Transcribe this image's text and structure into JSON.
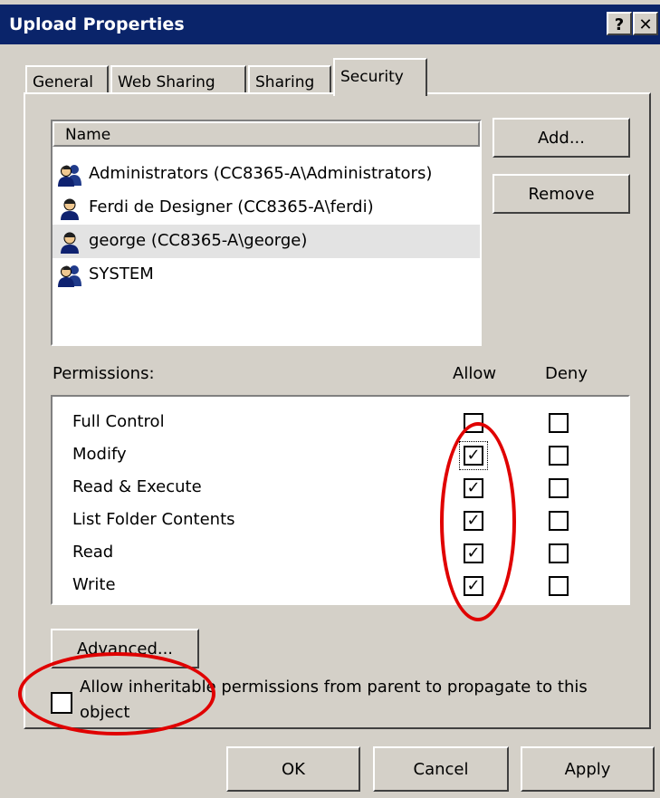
{
  "window": {
    "title": "Upload Properties",
    "help_label": "?",
    "close_label": "✕"
  },
  "tabs": [
    {
      "label": "General",
      "active": false
    },
    {
      "label": "Web Sharing",
      "active": false
    },
    {
      "label": "Sharing",
      "active": false
    },
    {
      "label": "Security",
      "active": true
    }
  ],
  "users": {
    "column_header": "Name",
    "items": [
      {
        "label": "Administrators (CC8365-A\\Administrators)",
        "icon": "group-users-icon",
        "selected": false
      },
      {
        "label": "Ferdi de Designer (CC8365-A\\ferdi)",
        "icon": "user-icon",
        "selected": false
      },
      {
        "label": "george (CC8365-A\\george)",
        "icon": "user-icon",
        "selected": true
      },
      {
        "label": "SYSTEM",
        "icon": "group-users-icon",
        "selected": false
      }
    ],
    "add_label": "Add...",
    "remove_label": "Remove"
  },
  "permissions": {
    "label": "Permissions:",
    "allow_header": "Allow",
    "deny_header": "Deny",
    "check_glyph": "✓",
    "rows": [
      {
        "name": "Full Control",
        "allow": false,
        "deny": false
      },
      {
        "name": "Modify",
        "allow": true,
        "deny": false
      },
      {
        "name": "Read & Execute",
        "allow": true,
        "deny": false
      },
      {
        "name": "List Folder Contents",
        "allow": true,
        "deny": false
      },
      {
        "name": "Read",
        "allow": true,
        "deny": false
      },
      {
        "name": "Write",
        "allow": true,
        "deny": false
      }
    ]
  },
  "advanced_label": "Advanced...",
  "inherit": {
    "line1": "Allow inheritable permissions from parent to propagate to this",
    "line2": "object",
    "checked": false
  },
  "footer": {
    "ok_label": "OK",
    "cancel_label": "Cancel",
    "apply_label": "Apply"
  },
  "colors": {
    "titlebar": "#0a246a",
    "dialog_bg": "#d4d0c8",
    "annotation_red": "#e00000"
  }
}
